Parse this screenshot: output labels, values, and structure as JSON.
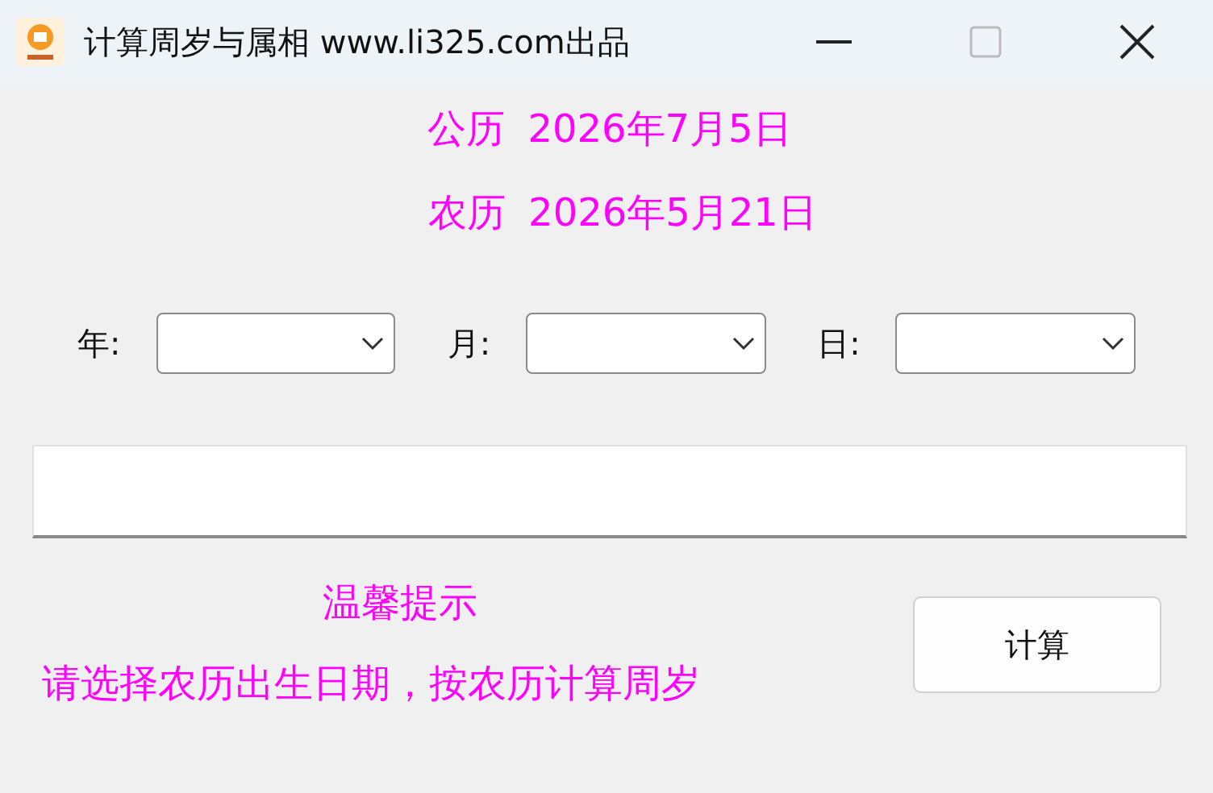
{
  "window": {
    "title": "计算周岁与属相 www.li325.com出品"
  },
  "dates": [
    {
      "label": "公历",
      "value": "2026年7月5日"
    },
    {
      "label": "农历",
      "value": "2026年5月21日"
    }
  ],
  "selectors": [
    {
      "label": "年:"
    },
    {
      "label": "月:"
    },
    {
      "label": "日:"
    }
  ],
  "hint": {
    "title": "温馨提示",
    "text": "请选择农历出生日期，按农历计算周岁"
  },
  "buttons": [
    "计算"
  ]
}
